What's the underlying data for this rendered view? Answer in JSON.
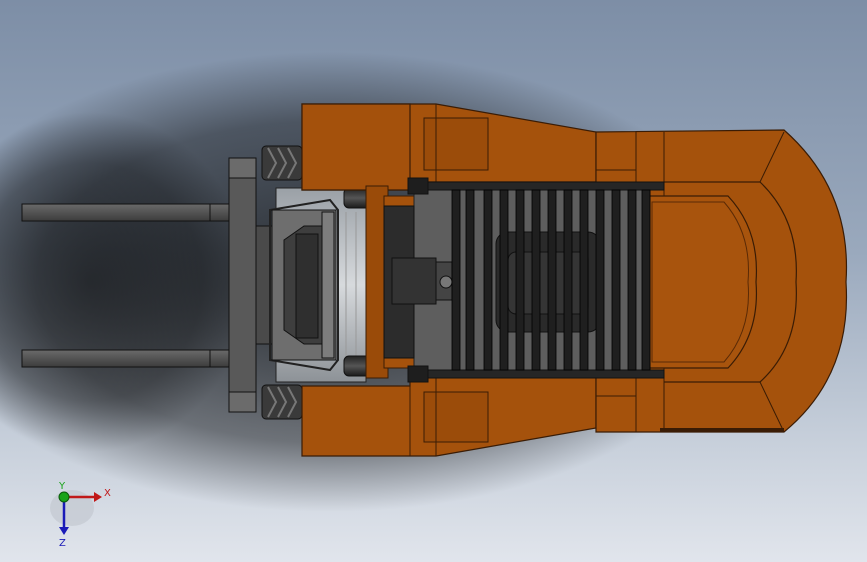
{
  "viewport": {
    "background_top": "#7d8ea6",
    "background_bottom": "#e1e5ec"
  },
  "model": {
    "body_color": "#a5520c",
    "body_edge": "#3a1c05",
    "body_shade": "#8e4508",
    "metal_color": "#5a5a5a",
    "metal_dark": "#2e2e2e",
    "tire_color": "#3a3a3a"
  },
  "triad": {
    "x_label": "X",
    "y_label": "Y",
    "z_label": "Z",
    "x_color": "#c01818",
    "y_color": "#19a319",
    "z_color": "#1a1ab8"
  }
}
